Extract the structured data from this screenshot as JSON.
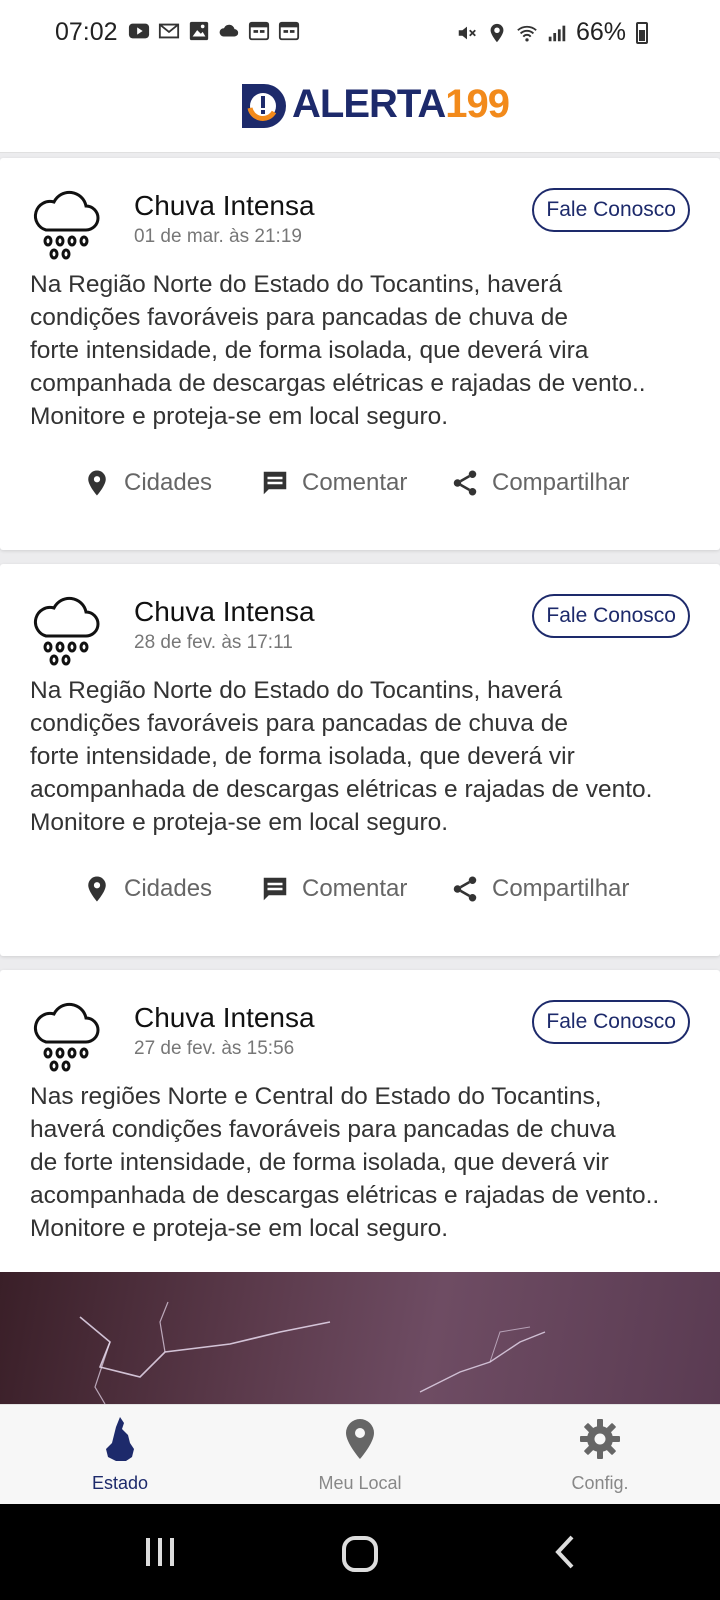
{
  "status_bar": {
    "time": "07:02",
    "battery": "66%",
    "left_icons": [
      "youtube-icon",
      "gmail-icon",
      "gallery-icon",
      "cloud-icon",
      "calendar-icon",
      "calendar-icon"
    ],
    "right_icons": [
      "mute-icon",
      "location-icon",
      "wifi-icon",
      "signal-icon",
      "battery-icon"
    ]
  },
  "header": {
    "logo_word": "ALERTA",
    "logo_number": "199",
    "brand_navy": "#1d2a6b",
    "brand_orange": "#f28a1b"
  },
  "alerts": [
    {
      "title": "Chuva Intensa",
      "date": "01 de mar. às 21:19",
      "contact_label": "Fale Conosco",
      "body": "Na Região Norte do Estado do Tocantins, haverá\ncondições favoráveis para pancadas de chuva de\nforte intensidade, de forma isolada, que deverá vira\ncompanhada de descargas elétricas e rajadas de vento..\nMonitore e proteja-se em local seguro.",
      "actions": {
        "cidades": "Cidades",
        "comentar": "Comentar",
        "compartilhar": "Compartilhar"
      }
    },
    {
      "title": "Chuva Intensa",
      "date": "28 de fev. às 17:11",
      "contact_label": "Fale Conosco",
      "body": "Na Região Norte do Estado do Tocantins, haverá\ncondições favoráveis para pancadas de chuva de\nforte intensidade, de forma isolada, que deverá vir\nacompanhada de descargas elétricas e rajadas de vento.\nMonitore e proteja-se em local seguro.",
      "actions": {
        "cidades": "Cidades",
        "comentar": "Comentar",
        "compartilhar": "Compartilhar"
      }
    },
    {
      "title": "Chuva Intensa",
      "date": "27 de fev. às 15:56",
      "contact_label": "Fale Conosco",
      "body": "Nas regiões Norte e Central do Estado do Tocantins,\nhaverá condições favoráveis para pancadas de chuva\nde forte intensidade, de forma isolada, que deverá vir\nacompanhada de descargas elétricas e rajadas de vento..\nMonitore e proteja-se em local seguro."
    }
  ],
  "bottom_nav": {
    "estado": "Estado",
    "meu_local": "Meu Local",
    "config": "Config.",
    "active": "estado"
  }
}
